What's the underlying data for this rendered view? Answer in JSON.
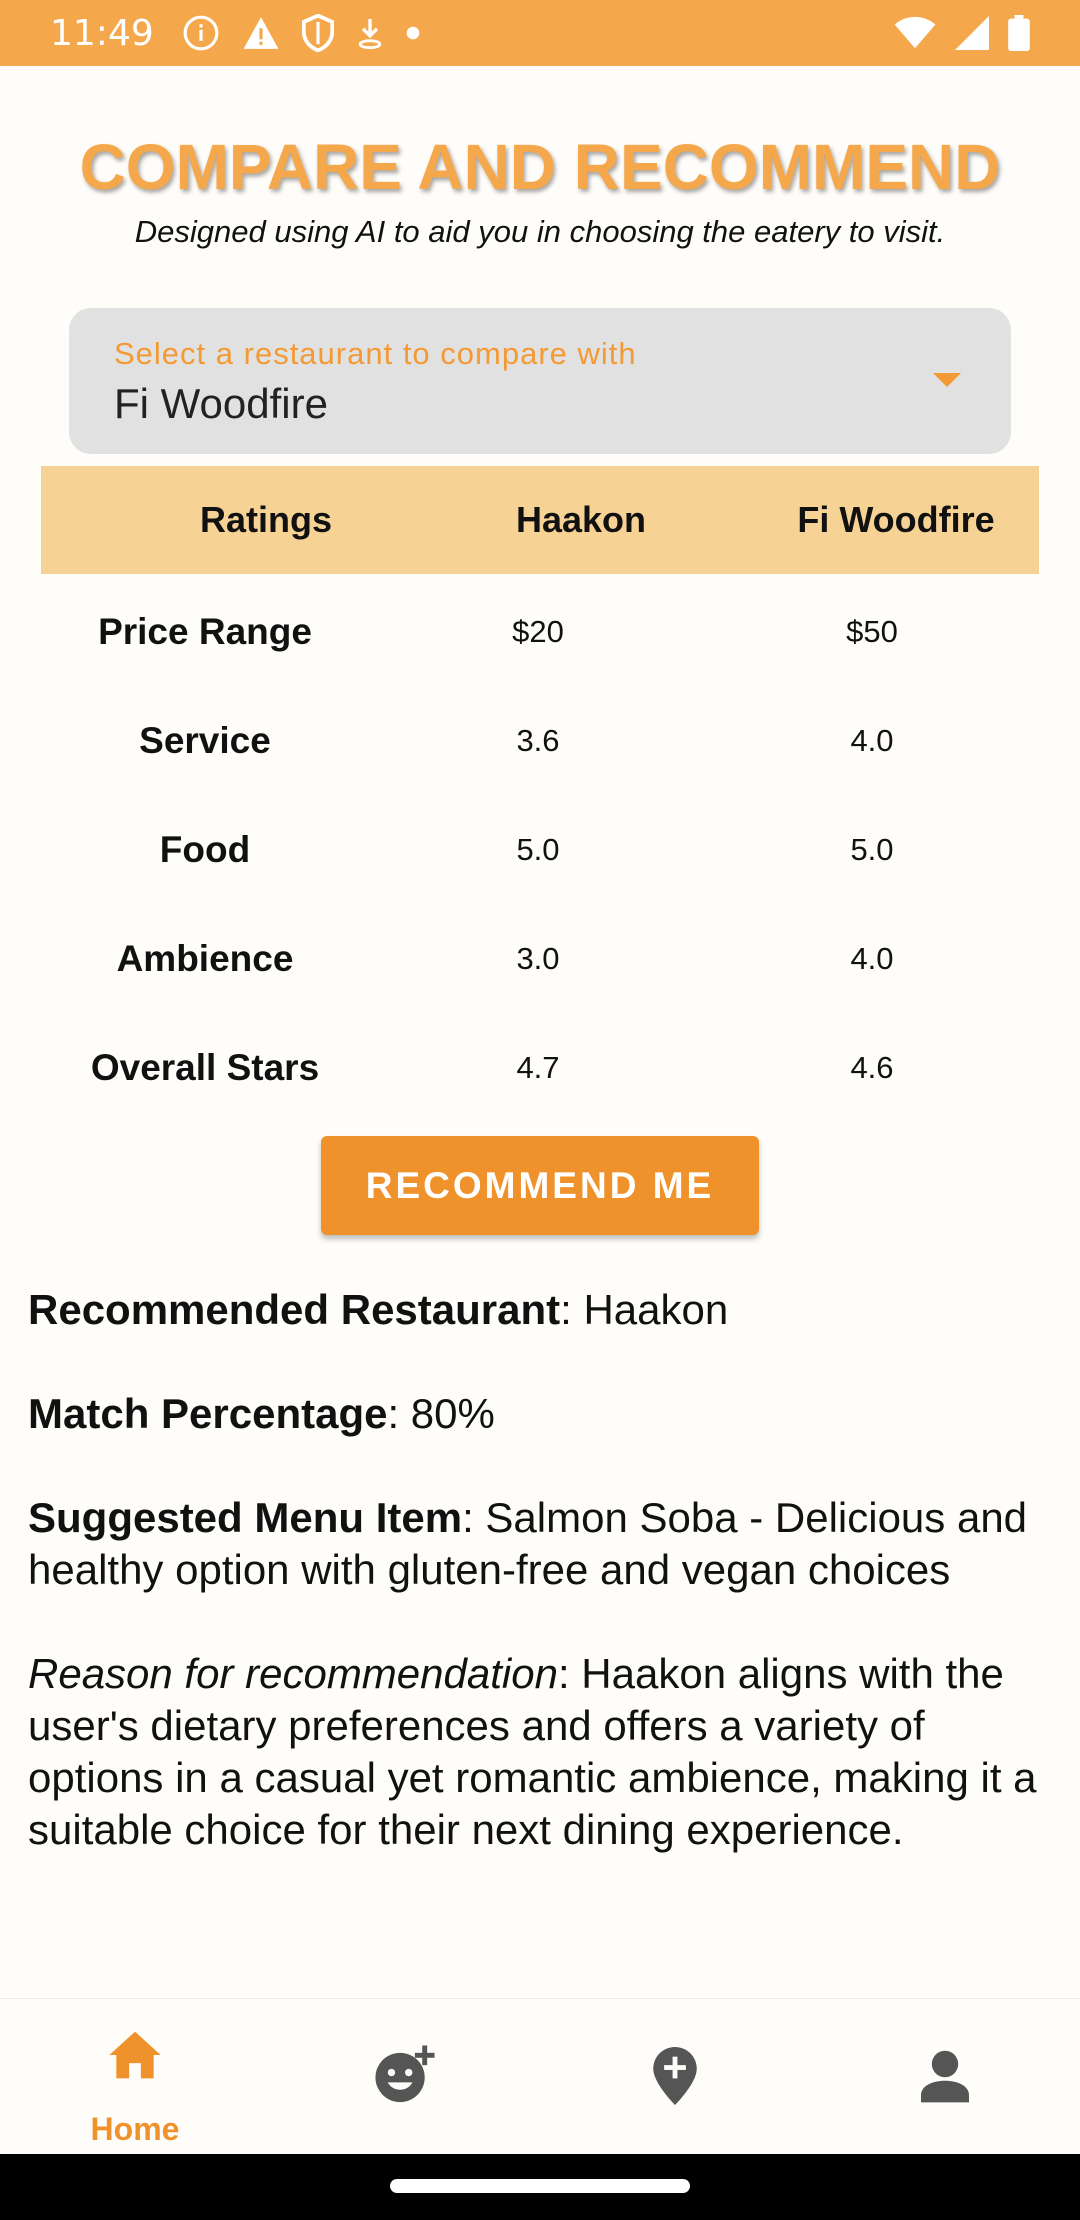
{
  "status_bar": {
    "time": "11:49",
    "left_icons": [
      "info-icon",
      "warning-icon",
      "shield-icon",
      "download-icon",
      "dot-icon"
    ],
    "right_icons": [
      "wifi-icon",
      "signal-icon",
      "battery-icon"
    ]
  },
  "header": {
    "title": "COMPARE AND RECOMMEND",
    "subtitle": "Designed using AI to aid you in choosing the eatery to visit."
  },
  "dropdown": {
    "label": "Select a restaurant to compare with",
    "selected": "Fi Woodfire"
  },
  "table": {
    "headers": [
      "Ratings",
      "Haakon",
      "Fi Woodfire"
    ],
    "rows": [
      {
        "label": "Price Range",
        "a": "$20",
        "b": "$50"
      },
      {
        "label": "Service",
        "a": "3.6",
        "b": "4.0"
      },
      {
        "label": "Food",
        "a": "5.0",
        "b": "5.0"
      },
      {
        "label": "Ambience",
        "a": "3.0",
        "b": "4.0"
      },
      {
        "label": "Overall Stars",
        "a": "4.7",
        "b": "4.6"
      }
    ]
  },
  "recommend_button": {
    "label": "RECOMMEND ME"
  },
  "result": {
    "restaurant_label": "Recommended Restaurant",
    "restaurant_value": ": Haakon",
    "match_label": "Match Percentage",
    "match_value": ": 80%",
    "menu_label": "Suggested Menu Item",
    "menu_value": ": Salmon Soba - Delicious and healthy option with gluten-free and vegan choices",
    "reason_label": "Reason for recommendation",
    "reason_value": ": Haakon aligns with the user's dietary preferences and offers a variety of options in a casual yet romantic ambience, making it a suitable choice for their next dining experience."
  },
  "bottom_nav": {
    "items": [
      {
        "label": "Home",
        "icon": "home-icon",
        "active": true
      },
      {
        "label": "",
        "icon": "add-reaction-icon",
        "active": false
      },
      {
        "label": "",
        "icon": "add-location-icon",
        "active": false
      },
      {
        "label": "",
        "icon": "person-icon",
        "active": false
      }
    ]
  },
  "colors": {
    "accent": "#F0922C",
    "status_bar": "#F5A84B",
    "table_header": "#F7D295",
    "dropdown_bg": "#E2E1E2",
    "inactive_icon": "#555555"
  }
}
